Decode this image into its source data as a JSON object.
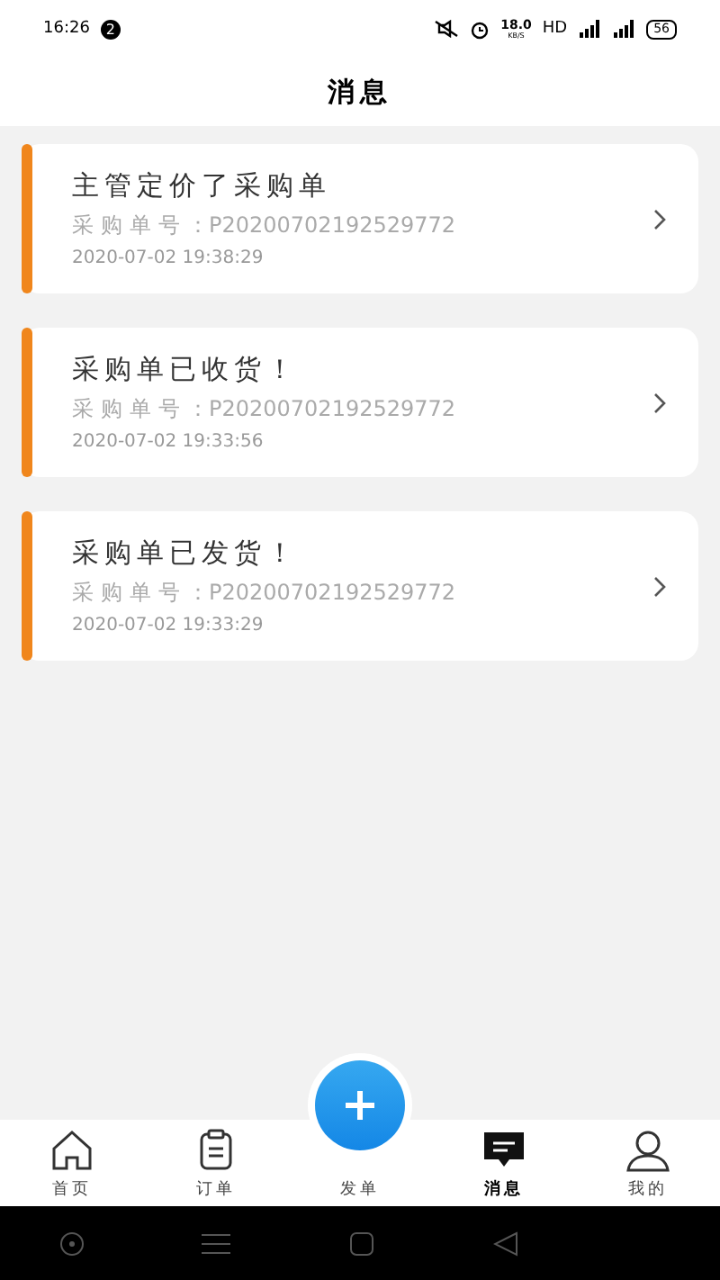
{
  "status_bar": {
    "time": "16:26",
    "notification_count": "2",
    "speed": "18.0",
    "speed_unit": "KB/S",
    "hd": "HD",
    "battery": "56"
  },
  "header": {
    "title": "消息"
  },
  "messages": [
    {
      "title": "主管定价了采购单",
      "order_label": "采购单号",
      "order_no": "：P20200702192529772",
      "time": "2020-07-02 19:38:29"
    },
    {
      "title": "采购单已收货！",
      "order_label": "采购单号",
      "order_no": "：P20200702192529772",
      "time": "2020-07-02 19:33:56"
    },
    {
      "title": "采购单已发货！",
      "order_label": "采购单号",
      "order_no": "：P20200702192529772",
      "time": "2020-07-02 19:33:29"
    }
  ],
  "tab_bar": [
    {
      "kind": "home",
      "label": "首页",
      "selected": false
    },
    {
      "kind": "orders",
      "label": "订单",
      "selected": false
    },
    {
      "kind": "add",
      "label": "发单",
      "selected": false
    },
    {
      "kind": "messages",
      "label": "消息",
      "selected": true
    },
    {
      "kind": "profile",
      "label": "我的",
      "selected": false
    }
  ]
}
